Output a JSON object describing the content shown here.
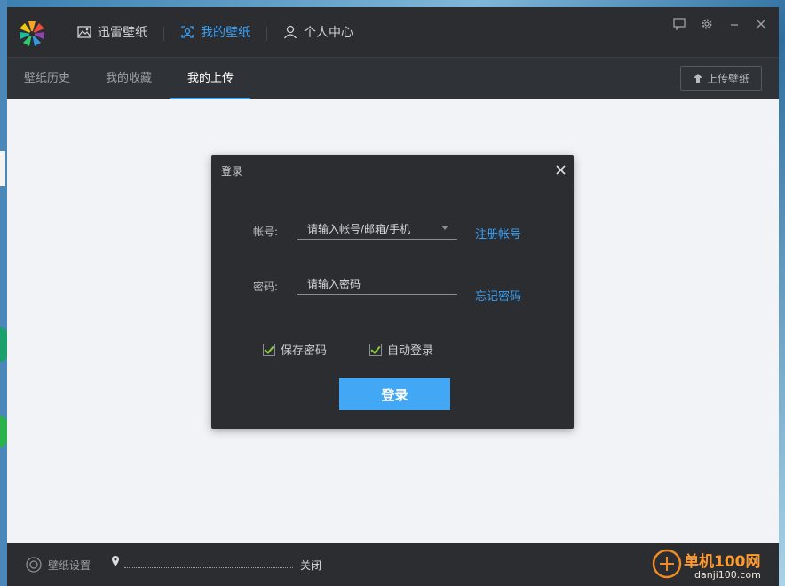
{
  "app": {
    "nav": [
      {
        "label": "迅雷壁纸",
        "icon": "image-icon"
      },
      {
        "label": "我的壁纸",
        "icon": "user-frame-icon"
      },
      {
        "label": "个人中心",
        "icon": "person-icon"
      }
    ],
    "window_buttons": [
      "feedback-icon",
      "gear-icon",
      "minimize-icon",
      "close-icon"
    ]
  },
  "tabs": [
    {
      "label": "壁纸历史"
    },
    {
      "label": "我的收藏"
    },
    {
      "label": "我的上传"
    }
  ],
  "upload_button": "上传壁纸",
  "bottom": {
    "settings_label": "壁纸设置",
    "close_label": "关闭"
  },
  "dialog": {
    "title": "登录",
    "account_label": "帐号:",
    "account_placeholder": "请输入帐号/邮箱/手机",
    "register_link": "注册帐号",
    "password_label": "密码:",
    "password_placeholder": "请输入密码",
    "forgot_link": "忘记密码",
    "save_password": "保存密码",
    "auto_login": "自动登录",
    "login_button": "登录"
  },
  "watermark": {
    "text1": "单机100网",
    "text2": "danji100.com"
  },
  "colors": {
    "accent": "#3aa0f5",
    "button": "#42a7f5",
    "check": "#8ccf3e"
  }
}
